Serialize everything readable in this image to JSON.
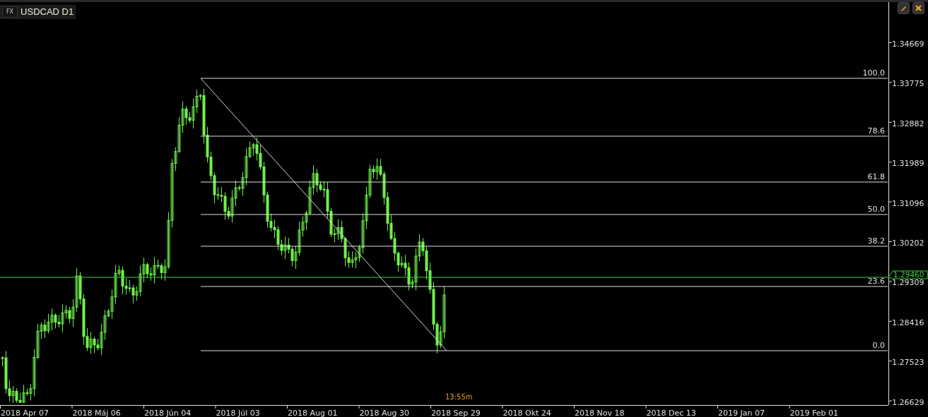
{
  "header": {
    "badge": "FX",
    "title": "USDCAD D1"
  },
  "toolbar": [
    {
      "kind": "pin"
    },
    {
      "kind": "close"
    }
  ],
  "fib_levels": [
    "100.0",
    "78.6",
    "61.8",
    "50.0",
    "38.2",
    "23.6",
    "0.0"
  ],
  "price_axis": [
    "1.34669",
    "1.33775",
    "1.32882",
    "1.31989",
    "1.31096",
    "1.30202",
    "1.29309",
    "1.28416",
    "1.27523",
    "1.26629"
  ],
  "current_price": "1.29460",
  "date_axis": [
    "2018 Apr 07",
    "2018 Máj 06",
    "2018 Jún 04",
    "2018 Júl 03",
    "2018 Aug 01",
    "2018 Aug 30",
    "2018 Sep 29",
    "2018 Okt 24",
    "2018 Nov 18",
    "2018 Dec 13",
    "2019 Jan 07",
    "2019 Feb 01"
  ],
  "timer": "13:55m"
}
